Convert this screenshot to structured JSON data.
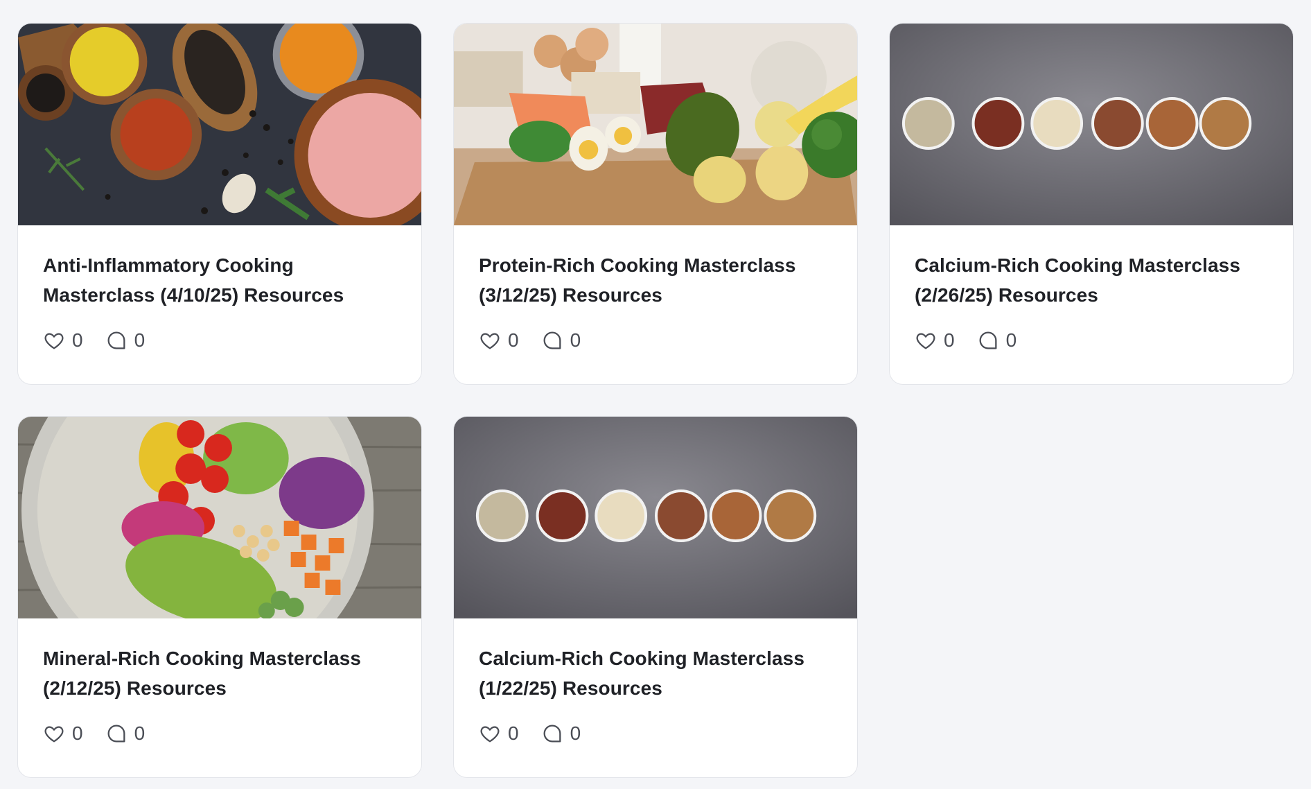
{
  "posts": [
    {
      "title": "Anti-Inflammatory Cooking Masterclass (4/10/25) Resources",
      "image": "spices-image",
      "likes": "0",
      "comments": "0"
    },
    {
      "title": "Protein-Rich Cooking Masterclass (3/12/25) Resources",
      "image": "protein-foods-image",
      "likes": "0",
      "comments": "0"
    },
    {
      "title": "Calcium-Rich Cooking Masterclass (2/26/25) Resources",
      "image": "nuts-bowls-image",
      "likes": "0",
      "comments": "0"
    },
    {
      "title": "Mineral-Rich Cooking Masterclass (2/12/25) Resources",
      "image": "salad-bowl-image",
      "likes": "0",
      "comments": "0"
    },
    {
      "title": "Calcium-Rich Cooking Masterclass (1/22/25) Resources",
      "image": "nuts-bowls-image",
      "likes": "0",
      "comments": "0"
    }
  ],
  "colors": {
    "page_bg": "#f4f5f8",
    "card_bg": "#ffffff",
    "title_text": "#1f2126",
    "meta_text": "#4a4d55"
  },
  "icons": {
    "like": "heart-icon",
    "comment": "comment-icon"
  }
}
